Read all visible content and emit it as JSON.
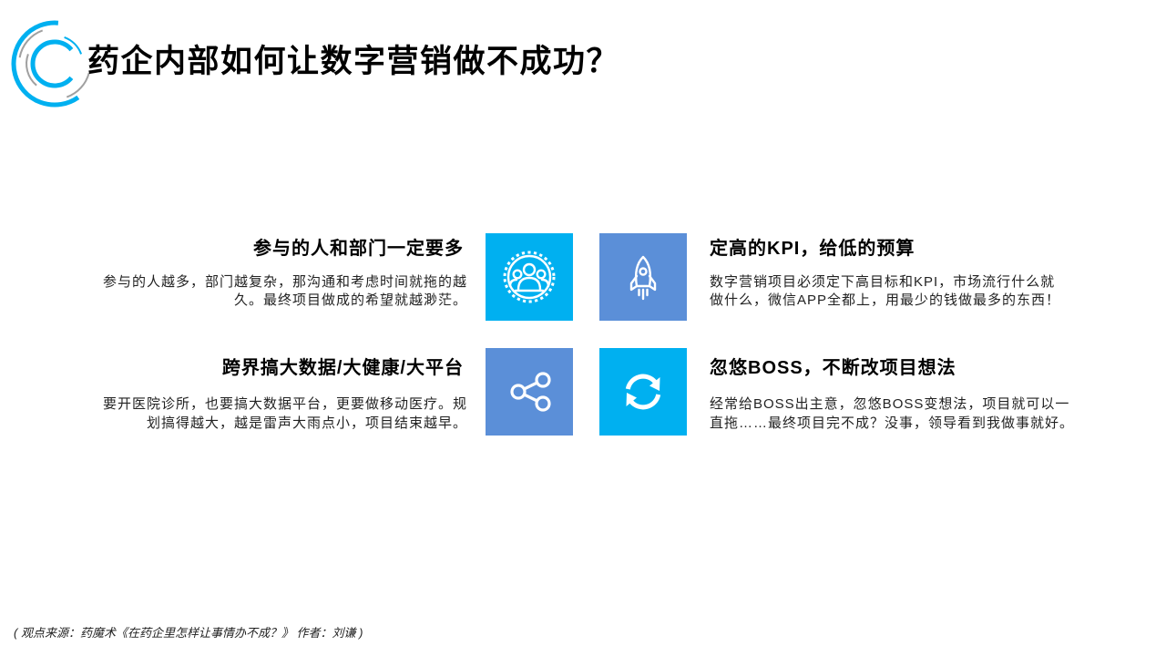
{
  "title": "药企内部如何让数字营销做不成功？",
  "colors": {
    "accent_cyan": "#00B0F0",
    "accent_blue": "#5B8FD8",
    "logo_gray": "#A0A0A0"
  },
  "items": [
    {
      "heading": "参与的人和部门一定要多",
      "body_lines": [
        "参与的人越多，部门越复杂，那沟通和考虑时间就拖的越",
        "久。最终项目做成的希望就越渺茫。"
      ],
      "icon": "team-icon",
      "tile_color": "#00B0F0"
    },
    {
      "heading": "定高的KPI，给低的预算",
      "body_lines": [
        "数字营销项目必须定下高目标和KPI，市场流行什么就",
        "做什么，微信APP全都上，用最少的钱做最多的东西！"
      ],
      "icon": "rocket-icon",
      "tile_color": "#5B8FD8"
    },
    {
      "heading": "跨界搞大数据/大健康/大平台",
      "body_lines": [
        "要开医院诊所，也要搞大数据平台，更要做移动医疗。规",
        "划搞得越大，越是雷声大雨点小，项目结束越早。"
      ],
      "icon": "share-icon",
      "tile_color": "#5B8FD8"
    },
    {
      "heading": "忽悠BOSS，不断改项目想法",
      "body_lines": [
        "经常给BOSS出主意，忽悠BOSS变想法，项目就可以一",
        "直拖……最终项目完不成？没事，领导看到我做事就好。"
      ],
      "icon": "refresh-icon",
      "tile_color": "#00B0F0"
    }
  ],
  "footer": "( 观点来源：药魔术《在药企里怎样让事情办不成？》 作者：刘谦 )"
}
